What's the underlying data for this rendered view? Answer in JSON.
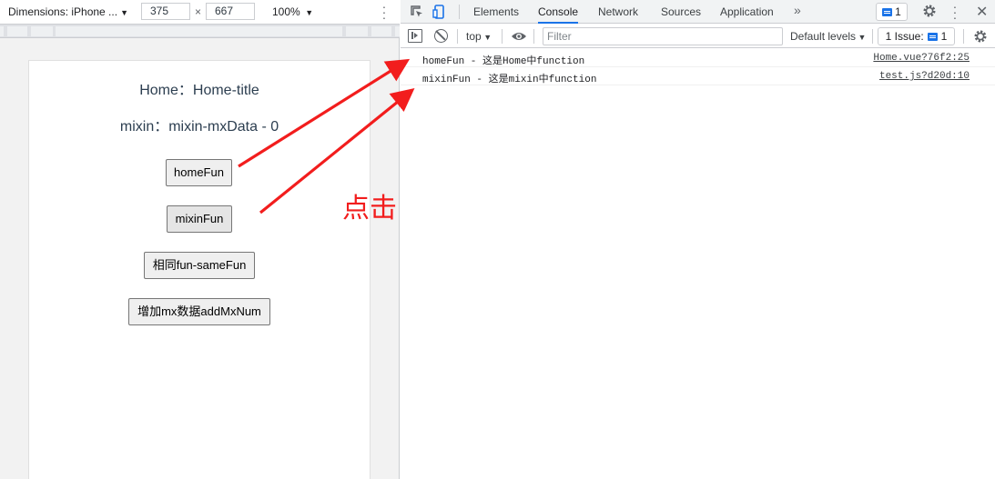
{
  "device_toolbar": {
    "dimensions_label": "Dimensions: iPhone ...",
    "width": "375",
    "times": "×",
    "height": "667",
    "zoom": "100%"
  },
  "app": {
    "home_line": "Home：Home-title",
    "mixin_line": "mixin：mixin-mxData - 0",
    "buttons": {
      "home": "homeFun",
      "mixin": "mixinFun",
      "same": "相同fun-sameFun",
      "add": "增加mx数据addMxNum"
    }
  },
  "devtools": {
    "tabs": [
      "Elements",
      "Console",
      "Network",
      "Sources",
      "Application"
    ],
    "active_tab": "Console",
    "more": "»",
    "messages_count": "1",
    "console_toolbar": {
      "context": "top",
      "filter_placeholder": "Filter",
      "levels": "Default levels",
      "issues_label": "1 Issue:",
      "issues_count": "1"
    },
    "logs": [
      {
        "message": "homeFun - 这是Home中function",
        "source": "Home.vue?76f2:25"
      },
      {
        "message": "mixinFun - 这是mixin中function",
        "source": "test.js?d20d:10"
      }
    ]
  },
  "annotation": {
    "click_note": "点击",
    "color": "#f21d1d"
  },
  "colors": {
    "accent": "#1a73e8",
    "arrow": "#f21d1d"
  }
}
